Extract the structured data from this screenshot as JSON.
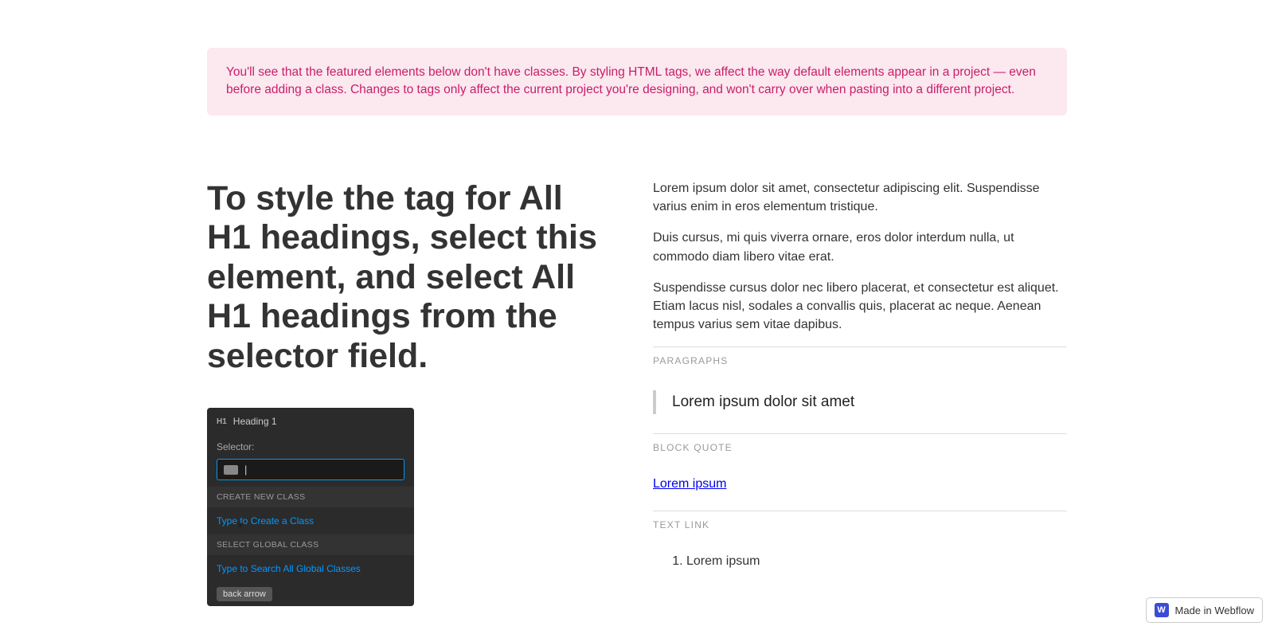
{
  "alert": {
    "text": "You'll see that the featured elements below don't have classes. By styling HTML tags, we affect the way default elements appear in a project — even before adding a class. Changes to tags only affect the current project you're designing, and won't carry over when pasting into a different project."
  },
  "left": {
    "heading": "To style the tag for All H1 headings, select this element, and select All H1 headings from the selector field.",
    "panel": {
      "tag_badge": "H1",
      "title": "Heading 1",
      "selector_label": "Selector:",
      "selector_cursor": "|",
      "create_label": "CREATE NEW CLASS",
      "create_action": "Type to Create a Class",
      "select_label": "SELECT GLOBAL CLASS",
      "select_action": "Type to Search All Global Classes",
      "tag": "back arrow"
    }
  },
  "right": {
    "paragraphs": [
      "Lorem ipsum dolor sit amet, consectetur adipiscing elit. Suspendisse varius enim in eros elementum tristique.",
      "Duis cursus, mi quis viverra ornare, eros dolor interdum nulla, ut commodo diam libero vitae erat.",
      "Suspendisse cursus dolor nec libero placerat, et consectetur est aliquet. Etiam lacus nisl, sodales a convallis quis, placerat ac neque. Aenean tempus varius sem vitae dapibus."
    ],
    "labels": {
      "paragraphs": "PARAGRAPHS",
      "blockquote": "BLOCK QUOTE",
      "textlink": "TEXT LINK"
    },
    "blockquote": "Lorem ipsum dolor sit amet",
    "link_text": "Lorem ipsum",
    "list": [
      "Lorem ipsum"
    ]
  },
  "badge": {
    "icon_letter": "W",
    "text": "Made in Webflow"
  }
}
